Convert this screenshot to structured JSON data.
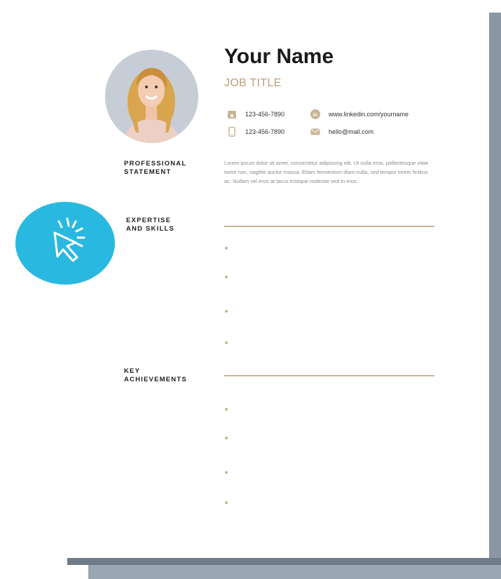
{
  "resume": {
    "name": "Your Name",
    "job_title": "JOB TITLE",
    "contacts": {
      "phone": "123-456-7890",
      "mobile": "123-456-7890",
      "linkedin": "www.linkedin.com/yourname",
      "email": "hello@mail.com"
    },
    "sections": {
      "statement_label_1": "PROFESSIONAL",
      "statement_label_2": "STATEMENT",
      "skills_label_1": "EXPERTISE",
      "skills_label_2": "AND SKILLS",
      "achievements_label_1": "KEY",
      "achievements_label_2": "ACHIEVEMENTS"
    },
    "statement_text": "Lorem ipsum dolor sit amet, consectetur adipiscing elit. Ut nulla eros, pellentesque vitae tortor non, sagittis auctor massa. Etiam fermentum diam nulla, sed tempor lorem finibus ac. Nullam vel eros at lacus tristique molestie sed in eros."
  },
  "icons": {
    "phone": "phone-icon",
    "mobile": "mobile-icon",
    "linkedin": "linkedin-icon",
    "email": "envelope-icon",
    "click": "click-cursor-icon"
  },
  "colors": {
    "accent": "#c8b595",
    "job_title": "#b9a07a",
    "badge": "#29b8e0",
    "shadow": "#8a96a3"
  }
}
